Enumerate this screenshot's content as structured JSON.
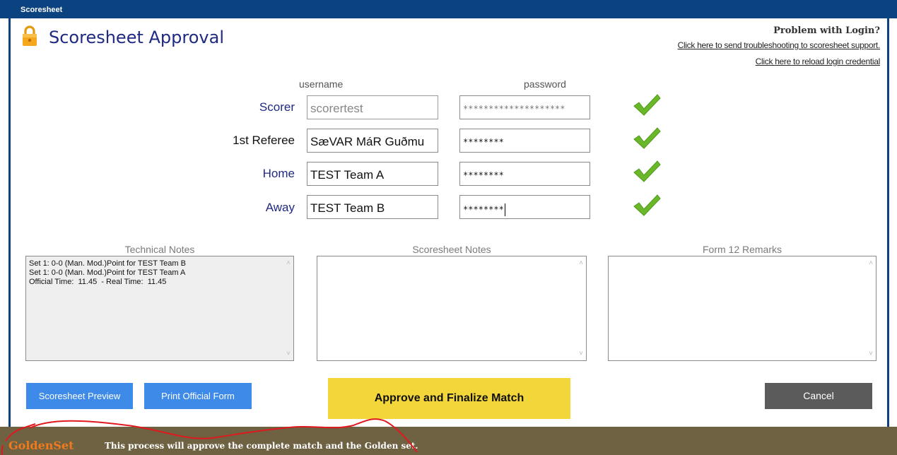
{
  "window": {
    "title": "Scoresheet"
  },
  "page_title": "Scoresheet Approval",
  "help": {
    "title": "Problem with Login?",
    "link_troubleshoot": "Click here to send troubleshooting to scoresheet support.",
    "link_reload": "Click here to reload login credential"
  },
  "columns": {
    "username": "username",
    "password": "password"
  },
  "login_rows": [
    {
      "label": "Scorer",
      "username": "scorertest",
      "password": "********************",
      "verified": true
    },
    {
      "label": "1st Referee",
      "username": "SæVAR MáR Guðmu",
      "password": "********",
      "verified": true
    },
    {
      "label": "Home",
      "username": "TEST Team A",
      "password": "********",
      "verified": true
    },
    {
      "label": "Away",
      "username": "TEST Team B",
      "password": "********",
      "verified": true
    }
  ],
  "notes": {
    "technical_title": "Technical Notes",
    "technical_text": "Set 1: 0-0 (Man. Mod.)Point for TEST Team B\nSet 1: 0-0 (Man. Mod.)Point for TEST Team A\nOfficial Time:  11.45  - Real Time:  11.45",
    "scoresheet_title": "Scoresheet Notes",
    "scoresheet_text": "",
    "form12_title": "Form 12 Remarks",
    "form12_text": ""
  },
  "buttons": {
    "preview": "Scoresheet Preview",
    "print": "Print Official Form",
    "approve": "Approve and Finalize Match",
    "cancel": "Cancel"
  },
  "status": {
    "brand": "GoldenSet",
    "message": "This process will approve the complete match and the Golden set."
  },
  "colors": {
    "titlebar": "#0b4280",
    "label_blue": "#1f2a82",
    "button_blue": "#3d8ae8",
    "approve_yellow": "#f2d63a",
    "cancel_gray": "#5b5b5b",
    "status_bar": "#6e6243",
    "brand_orange": "#f07a1c",
    "check_green": "#6ab82a"
  },
  "icons": {
    "lock": "lock-icon",
    "check": "checkmark-icon"
  }
}
